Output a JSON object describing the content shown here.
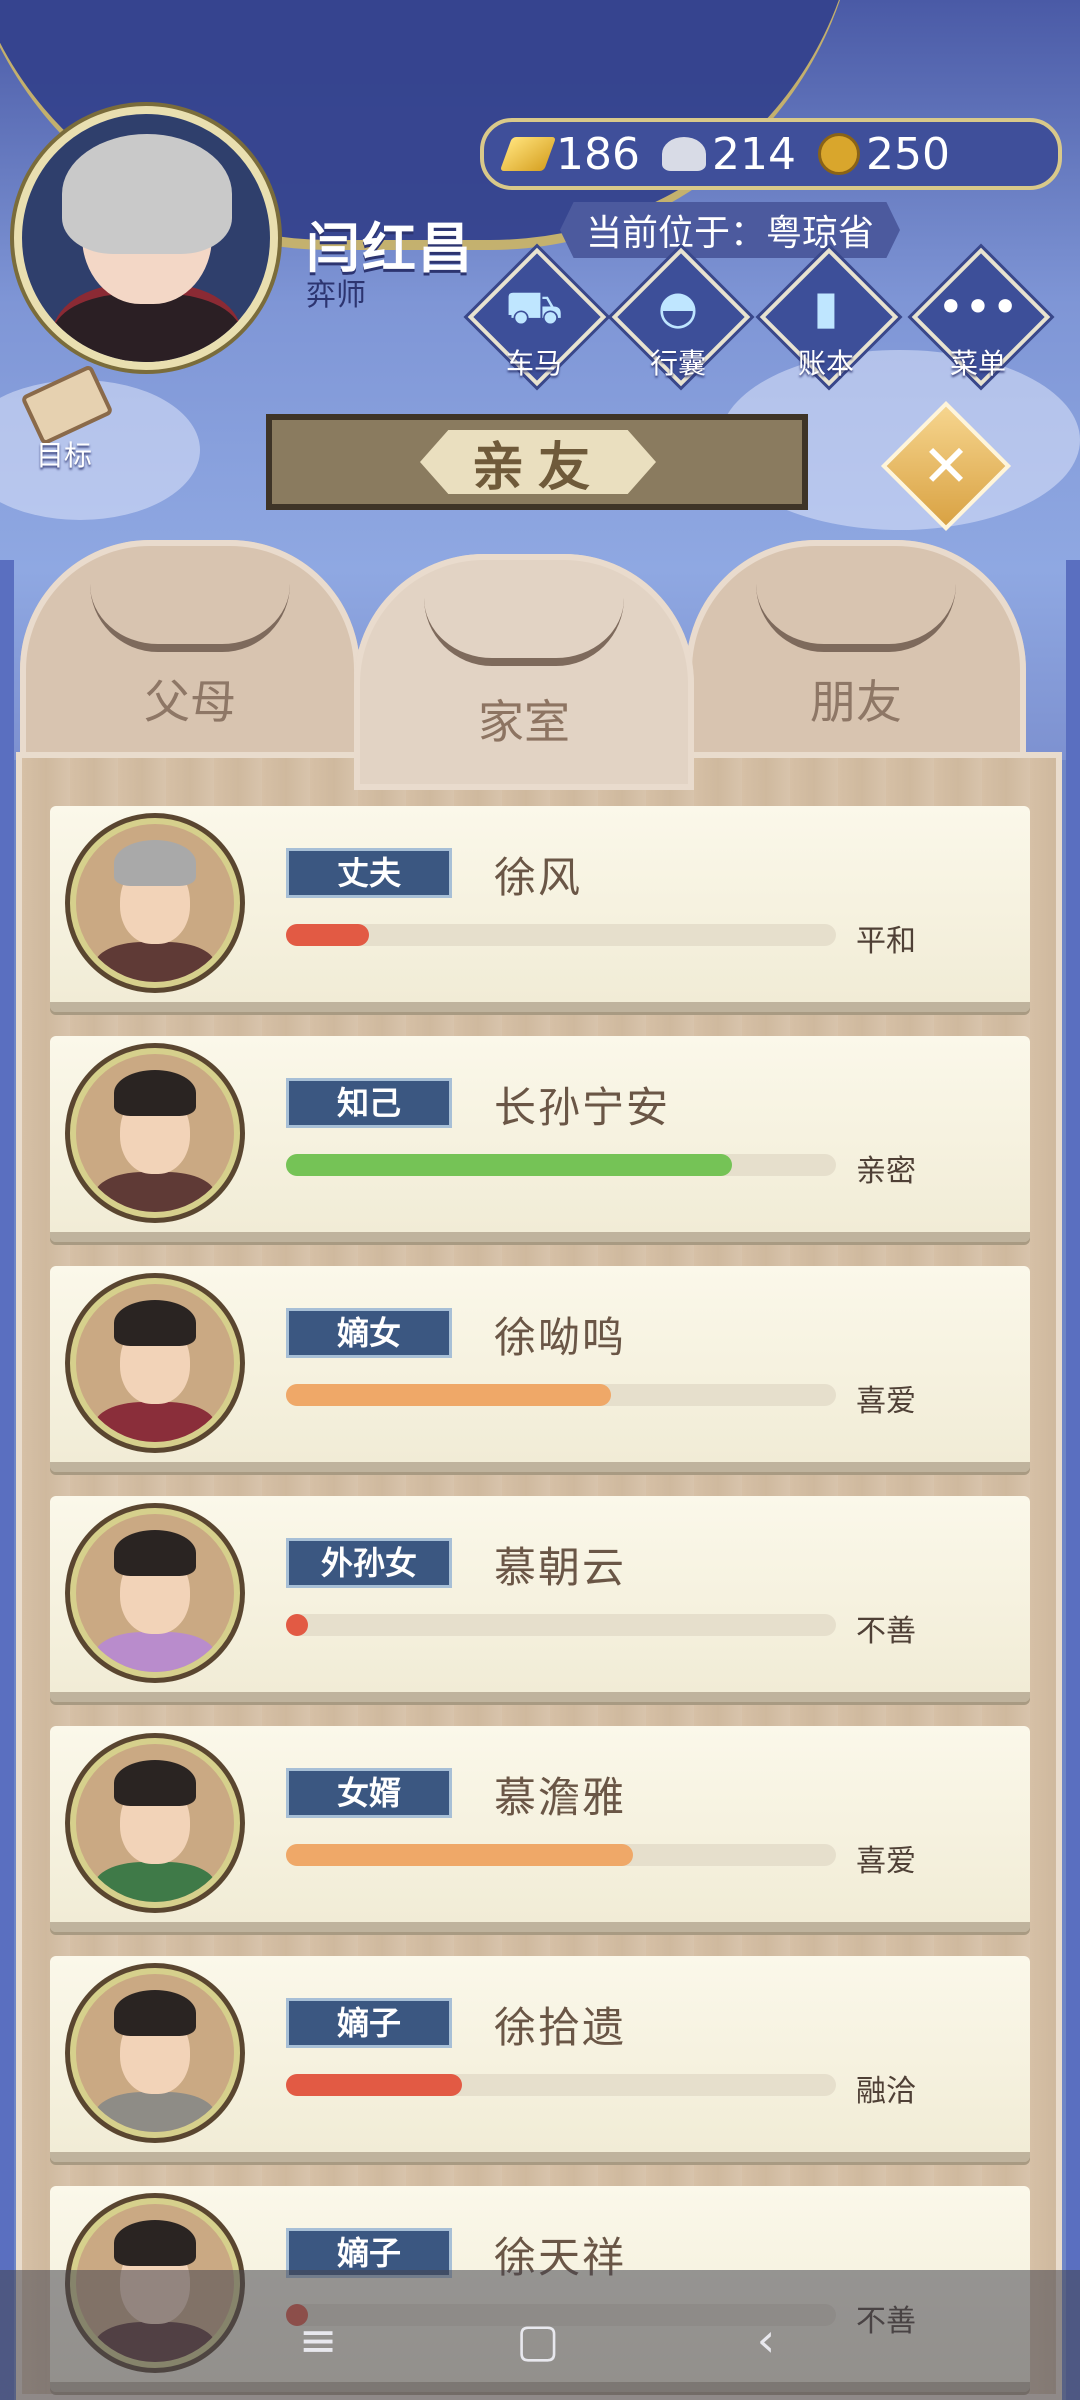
{
  "header": {
    "player_name": "闫红昌",
    "player_title": "弈师",
    "currency": {
      "gold": "186",
      "silver": "214",
      "coins": "250"
    },
    "location_label": "当前位于：粤琼省",
    "buttons": [
      {
        "label": "车马",
        "icon": "carriage-icon"
      },
      {
        "label": "行囊",
        "icon": "bag-icon"
      },
      {
        "label": "账本",
        "icon": "ledger-icon"
      },
      {
        "label": "菜单",
        "icon": "menu-dots-icon"
      }
    ],
    "goal_label": "目标"
  },
  "title": "亲友",
  "tabs": [
    {
      "label": "父母",
      "active": false
    },
    {
      "label": "家室",
      "active": true
    },
    {
      "label": "朋友",
      "active": false
    }
  ],
  "relatives": [
    {
      "relation": "丈夫",
      "name": "徐风",
      "status": "平和",
      "level": 0.15,
      "bar_color": "#e25a44"
    },
    {
      "relation": "知己",
      "name": "长孙宁安",
      "status": "亲密",
      "level": 0.81,
      "bar_color": "#75c356"
    },
    {
      "relation": "嫡女",
      "name": "徐呦鸣",
      "status": "喜爱",
      "level": 0.59,
      "bar_color": "#efa868"
    },
    {
      "relation": "外孙女",
      "name": "慕朝云",
      "status": "不善",
      "level": 0.04,
      "bar_color": "#e25a44"
    },
    {
      "relation": "女婿",
      "name": "慕澹雅",
      "status": "喜爱",
      "level": 0.63,
      "bar_color": "#efa868"
    },
    {
      "relation": "嫡子",
      "name": "徐拾遗",
      "status": "融洽",
      "level": 0.32,
      "bar_color": "#e25a44"
    },
    {
      "relation": "嫡子",
      "name": "徐天祥",
      "status": "不善",
      "level": 0.04,
      "bar_color": "#e25a44"
    }
  ],
  "system_nav": {
    "menu": "≡",
    "home": "▢",
    "back": "‹"
  }
}
